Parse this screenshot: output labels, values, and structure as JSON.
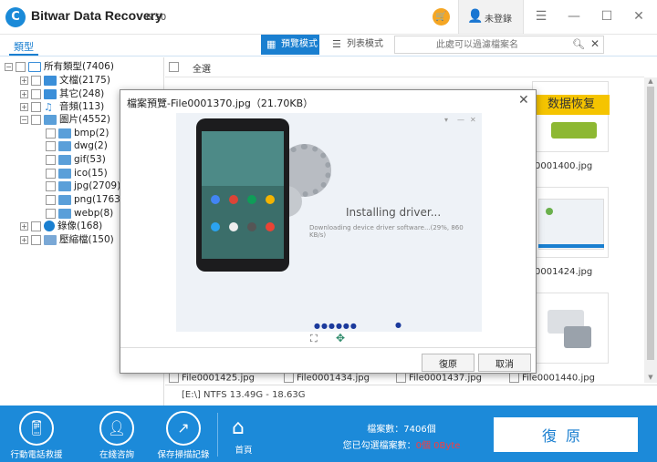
{
  "app": {
    "logo": "C",
    "title": "Bitwar Data Recovery",
    "version": "6.50",
    "user_label": "未登錄"
  },
  "toolbar": {
    "tab_type": "類型",
    "view_preview": "預覽模式",
    "view_list": "列表模式",
    "search_placeholder": "此處可以過濾檔案名"
  },
  "tree": [
    {
      "label": "所有類型(7406)"
    },
    {
      "label": "文檔(2175)"
    },
    {
      "label": "其它(248)"
    },
    {
      "label": "音頻(113)"
    },
    {
      "label": "圖片(4552)"
    },
    {
      "label": "bmp(2)"
    },
    {
      "label": "dwg(2)"
    },
    {
      "label": "gif(53)"
    },
    {
      "label": "ico(15)"
    },
    {
      "label": "jpg(2709)"
    },
    {
      "label": "png(1763)"
    },
    {
      "label": "webp(8)"
    },
    {
      "label": "錄像(168)"
    },
    {
      "label": "壓縮檔(150)"
    }
  ],
  "grid": {
    "select_all": "全選",
    "thumb_text": "数据恢复",
    "files": [
      "0001400.jpg",
      "0001424.jpg",
      "File0001425.jpg",
      "File0001434.jpg",
      "File0001437.jpg",
      "File0001440.jpg"
    ]
  },
  "status": {
    "drive_info": "[E:\\] NTFS 13.49G - 18.63G"
  },
  "bottom": {
    "mobile": "行動電話救援",
    "online": "在綫咨詢",
    "save_scan": "保存掃描記錄",
    "home": "首頁",
    "file_count_label": "檔案數：7406個",
    "selected_prefix": "您已勾選檔案數：",
    "selected_count": "0個",
    "selected_size": "0Byte",
    "restore": "復原"
  },
  "modal": {
    "title": "檔案預覽-File0001370.jpg（21.70KB）",
    "installing": "Installing driver...",
    "installing_sub": "Downloading device driver software...(29%, 860 KB/s)",
    "restore": "復原",
    "cancel": "取消"
  },
  "colors": {
    "accent": "#1a7fd0",
    "bottom_bar": "#1c8ad9",
    "cart": "#f5a623",
    "alert": "#ff3b3b"
  }
}
